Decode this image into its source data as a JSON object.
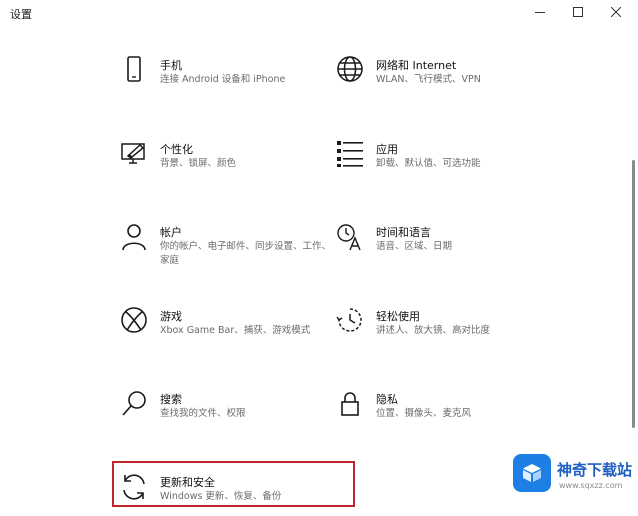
{
  "window": {
    "title": "设置"
  },
  "tiles": [
    {
      "id": "phone",
      "title": "手机",
      "desc": "连接 Android 设备和 iPhone",
      "icon": "phone-icon"
    },
    {
      "id": "network",
      "title": "网络和 Internet",
      "desc": "WLAN、飞行模式、VPN",
      "icon": "globe-icon"
    },
    {
      "id": "personalization",
      "title": "个性化",
      "desc": "背景、锁屏、颜色",
      "icon": "personalization-icon"
    },
    {
      "id": "apps",
      "title": "应用",
      "desc": "卸载、默认值、可选功能",
      "icon": "apps-list-icon"
    },
    {
      "id": "accounts",
      "title": "帐户",
      "desc": "你的帐户、电子邮件、同步设置、工作、家庭",
      "icon": "person-icon"
    },
    {
      "id": "time-language",
      "title": "时间和语言",
      "desc": "语音、区域、日期",
      "icon": "time-language-icon"
    },
    {
      "id": "gaming",
      "title": "游戏",
      "desc": "Xbox Game Bar、捕获、游戏模式",
      "icon": "xbox-icon"
    },
    {
      "id": "ease-of-access",
      "title": "轻松使用",
      "desc": "讲述人、放大镜、高对比度",
      "icon": "ease-of-access-icon"
    },
    {
      "id": "search",
      "title": "搜索",
      "desc": "查找我的文件、权限",
      "icon": "search-icon"
    },
    {
      "id": "privacy",
      "title": "隐私",
      "desc": "位置、摄像头、麦克风",
      "icon": "lock-icon"
    },
    {
      "id": "update-security",
      "title": "更新和安全",
      "desc": "Windows 更新、恢复、备份",
      "icon": "sync-icon"
    }
  ],
  "watermark": {
    "name": "神奇下载站",
    "url": "www.sqxzz.com"
  },
  "colors": {
    "accent": "#1d7fe3",
    "icon": "#1a1a1a",
    "highlight": "#c0262d"
  }
}
